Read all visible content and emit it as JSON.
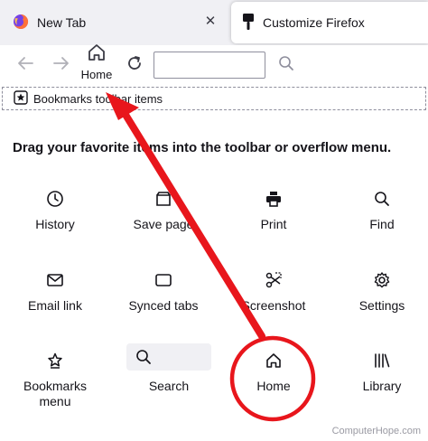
{
  "tabs": [
    {
      "label": "New Tab",
      "icon": "firefox-logo-icon",
      "close": "✕"
    },
    {
      "label": "Customize Firefox",
      "icon": "paintbrush-icon"
    }
  ],
  "nav": {
    "home_label": "Home"
  },
  "bookmarks_toolbar": {
    "label": "Bookmarks toolbar items"
  },
  "heading": "Drag your favorite items into the toolbar or overflow menu.",
  "items": [
    {
      "label": "History",
      "icon": "clock-icon"
    },
    {
      "label": "Save page",
      "icon": "save-page-icon"
    },
    {
      "label": "Print",
      "icon": "printer-icon"
    },
    {
      "label": "Find",
      "icon": "magnifier-icon"
    },
    {
      "label": "Email link",
      "icon": "envelope-icon"
    },
    {
      "label": "Synced tabs",
      "icon": "synced-tabs-icon"
    },
    {
      "label": "Screenshot",
      "icon": "scissors-icon"
    },
    {
      "label": "Settings",
      "icon": "gear-icon"
    },
    {
      "label": "Bookmarks menu",
      "icon": "star-icon"
    },
    {
      "label": "Search",
      "icon": "magnifier-icon"
    },
    {
      "label": "Home",
      "icon": "home-icon"
    },
    {
      "label": "Library",
      "icon": "library-icon"
    }
  ],
  "watermark": "ComputerHope.com",
  "colors": {
    "annotation": "#e8161c",
    "tabbar_bg": "#f0f0f4"
  }
}
